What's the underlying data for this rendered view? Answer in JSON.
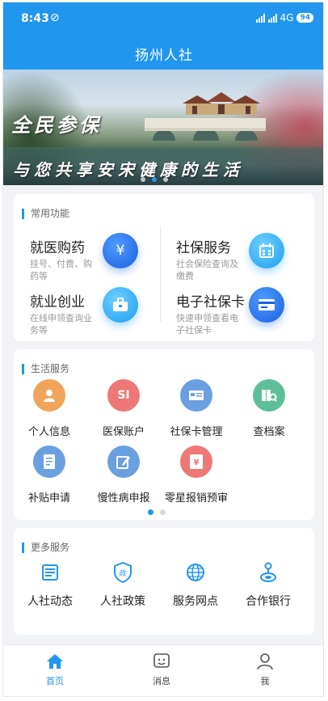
{
  "status_bar": {
    "time": "8:43",
    "network": "4G",
    "battery": "94"
  },
  "header": {
    "title": "扬州人社"
  },
  "banner": {
    "line1": "全民参保",
    "line2": "与您共享安宋健康的生活",
    "active_slide": 1,
    "slide_count": 3
  },
  "common_functions": {
    "title": "常用功能",
    "items": [
      {
        "title": "就医购药",
        "subtitle": "挂号、付费、购药等",
        "icon": "money-bag-icon"
      },
      {
        "title": "社保服务",
        "subtitle": "社会保险查询及缴费",
        "icon": "calendar-icon"
      },
      {
        "title": "就业创业",
        "subtitle": "在线申领查询业务等",
        "icon": "briefcase-icon"
      },
      {
        "title": "电子社保卡",
        "subtitle": "快速申领查看电子社保卡",
        "icon": "card-icon"
      }
    ]
  },
  "life_services": {
    "title": "生活服务",
    "items": [
      {
        "label": "个人信息",
        "icon": "person-icon",
        "color": "#f0a45a"
      },
      {
        "label": "医保账户",
        "icon": "si-icon",
        "color": "#ee7777"
      },
      {
        "label": "社保卡管理",
        "icon": "social-card-icon",
        "color": "#6a9fe0"
      },
      {
        "label": "查档案",
        "icon": "archive-icon",
        "color": "#5dbf9a"
      },
      {
        "label": "补贴申请",
        "icon": "application-icon",
        "color": "#6a9fe0"
      },
      {
        "label": "慢性病申报",
        "icon": "edit-icon",
        "color": "#6a9fe0"
      },
      {
        "label": "零星报销预审",
        "icon": "yen-bill-icon",
        "color": "#ee7777"
      }
    ],
    "active_page": 1,
    "page_count": 2
  },
  "more_services": {
    "title": "更多服务",
    "items": [
      {
        "label": "人社动态",
        "icon": "news-icon"
      },
      {
        "label": "人社政策",
        "icon": "policy-shield-icon"
      },
      {
        "label": "服务网点",
        "icon": "globe-icon"
      },
      {
        "label": "合作银行",
        "icon": "bank-icon"
      }
    ]
  },
  "tab_bar": {
    "items": [
      {
        "label": "首页",
        "icon": "home-icon",
        "active": true
      },
      {
        "label": "消息",
        "icon": "message-icon",
        "active": false
      },
      {
        "label": "我",
        "icon": "user-icon",
        "active": false
      }
    ]
  },
  "colors": {
    "primary": "#2196ee",
    "background": "#f1f3f6"
  }
}
